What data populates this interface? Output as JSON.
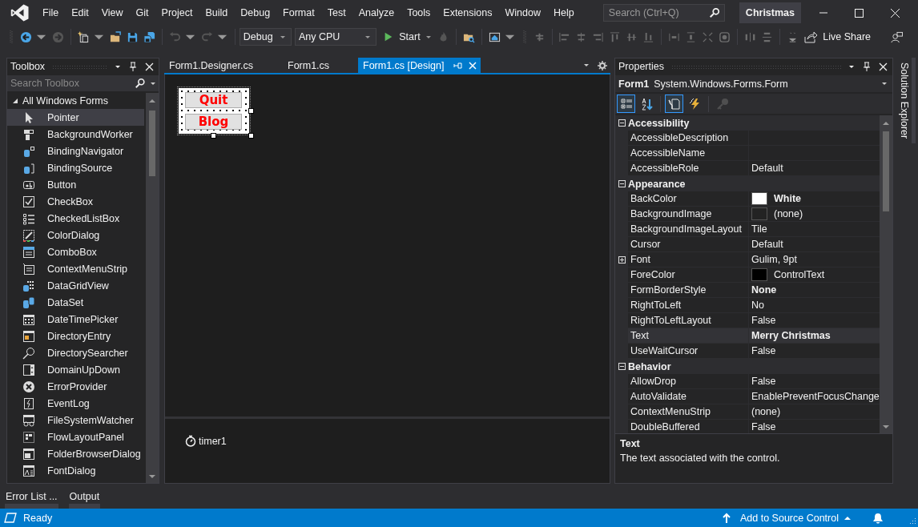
{
  "menu": [
    {
      "label": "File"
    },
    {
      "label": "Edit"
    },
    {
      "label": "View"
    },
    {
      "label": "Git"
    },
    {
      "label": "Project"
    },
    {
      "label": "Build"
    },
    {
      "label": "Debug"
    },
    {
      "label": "Format"
    },
    {
      "label": "Test"
    },
    {
      "label": "Analyze"
    },
    {
      "label": "Tools"
    },
    {
      "label": "Extensions"
    },
    {
      "label": "Window"
    },
    {
      "label": "Help"
    }
  ],
  "search": {
    "placeholder": "Search (Ctrl+Q)"
  },
  "solution_name": "Christmas",
  "toolbar": {
    "configuration": "Debug",
    "platform": "Any CPU",
    "start": "Start",
    "live_share": "Live Share"
  },
  "toolbox": {
    "title": "Toolbox",
    "search": {
      "placeholder": "Search Toolbox"
    },
    "group": {
      "label": "All Windows Forms",
      "expanded": true
    },
    "items": [
      {
        "label": "Pointer",
        "selected": true
      },
      {
        "label": "BackgroundWorker",
        "selected": false
      },
      {
        "label": "BindingNavigator",
        "selected": false
      },
      {
        "label": "BindingSource",
        "selected": false
      },
      {
        "label": "Button",
        "selected": false
      },
      {
        "label": "CheckBox",
        "selected": false
      },
      {
        "label": "CheckedListBox",
        "selected": false
      },
      {
        "label": "ColorDialog",
        "selected": false
      },
      {
        "label": "ComboBox",
        "selected": false
      },
      {
        "label": "ContextMenuStrip",
        "selected": false
      },
      {
        "label": "DataGridView",
        "selected": false
      },
      {
        "label": "DataSet",
        "selected": false
      },
      {
        "label": "DateTimePicker",
        "selected": false
      },
      {
        "label": "DirectoryEntry",
        "selected": false
      },
      {
        "label": "DirectorySearcher",
        "selected": false
      },
      {
        "label": "DomainUpDown",
        "selected": false
      },
      {
        "label": "ErrorProvider",
        "selected": false
      },
      {
        "label": "EventLog",
        "selected": false
      },
      {
        "label": "FileSystemWatcher",
        "selected": false
      },
      {
        "label": "FlowLayoutPanel",
        "selected": false
      },
      {
        "label": "FolderBrowserDialog",
        "selected": false
      },
      {
        "label": "FontDialog",
        "selected": false
      }
    ]
  },
  "editor": {
    "tabs": [
      {
        "label": "Form1.Designer.cs",
        "selected": false
      },
      {
        "label": "Form1.cs",
        "selected": false
      },
      {
        "label": "Form1.cs [Design]",
        "selected": true
      }
    ],
    "form_buttons": [
      {
        "label": "Quit"
      },
      {
        "label": "Blog"
      }
    ],
    "components": [
      {
        "label": "timer1"
      }
    ]
  },
  "properties": {
    "title": "Properties",
    "object_name": "Form1",
    "object_type": "System.Windows.Forms.Form",
    "view_buttons": [
      {
        "kind": "categorized",
        "selected": true,
        "disabled": false
      },
      {
        "kind": "alphabetical",
        "selected": false,
        "disabled": false
      },
      {
        "kind": "properties",
        "selected": true,
        "disabled": false
      },
      {
        "kind": "events",
        "selected": false,
        "disabled": false
      },
      {
        "kind": "pages",
        "selected": false,
        "disabled": true
      }
    ],
    "categories": [
      {
        "label": "Accessibility",
        "expanded": true,
        "rows": [
          {
            "name": "AccessibleDescription",
            "selected": false
          },
          {
            "name": "AccessibleName",
            "selected": false
          },
          {
            "name": "AccessibleRole",
            "value": "Default",
            "selected": false
          }
        ]
      },
      {
        "label": "Appearance",
        "expanded": true,
        "rows": [
          {
            "name": "BackColor",
            "value": "White",
            "bold": true,
            "color": "#ffffff",
            "selected": false
          },
          {
            "name": "BackgroundImage",
            "value": "(none)",
            "color": "#232323",
            "selected": false
          },
          {
            "name": "BackgroundImageLayout",
            "value": "Tile",
            "selected": false
          },
          {
            "name": "Cursor",
            "value": "Default",
            "selected": false
          },
          {
            "name": "Font",
            "value": "Gulim, 9pt",
            "expandable": true,
            "selected": false
          },
          {
            "name": "ForeColor",
            "value": "ControlText",
            "color": "#000000",
            "selected": false
          },
          {
            "name": "FormBorderStyle",
            "value": "None",
            "bold": true,
            "selected": false
          },
          {
            "name": "RightToLeft",
            "value": "No",
            "selected": false
          },
          {
            "name": "RightToLeftLayout",
            "value": "False",
            "selected": false
          },
          {
            "name": "Text",
            "value": "Merry Christmas",
            "bold": true,
            "selected": true
          },
          {
            "name": "UseWaitCursor",
            "value": "False",
            "selected": false
          }
        ]
      },
      {
        "label": "Behavior",
        "expanded": true,
        "rows": [
          {
            "name": "AllowDrop",
            "value": "False",
            "selected": false
          },
          {
            "name": "AutoValidate",
            "value": "EnablePreventFocusChange",
            "selected": false
          },
          {
            "name": "ContextMenuStrip",
            "value": "(none)",
            "selected": false
          },
          {
            "name": "DoubleBuffered",
            "value": "False",
            "selected": false
          }
        ]
      }
    ],
    "description": {
      "title": "Text",
      "text": "The text associated with the control."
    }
  },
  "side_tab": "Solution Explorer",
  "bottom_tabs": [
    {
      "label": "Error List ..."
    },
    {
      "label": "Output"
    }
  ],
  "status": {
    "text": "Ready",
    "source_control": "Add to Source Control"
  }
}
